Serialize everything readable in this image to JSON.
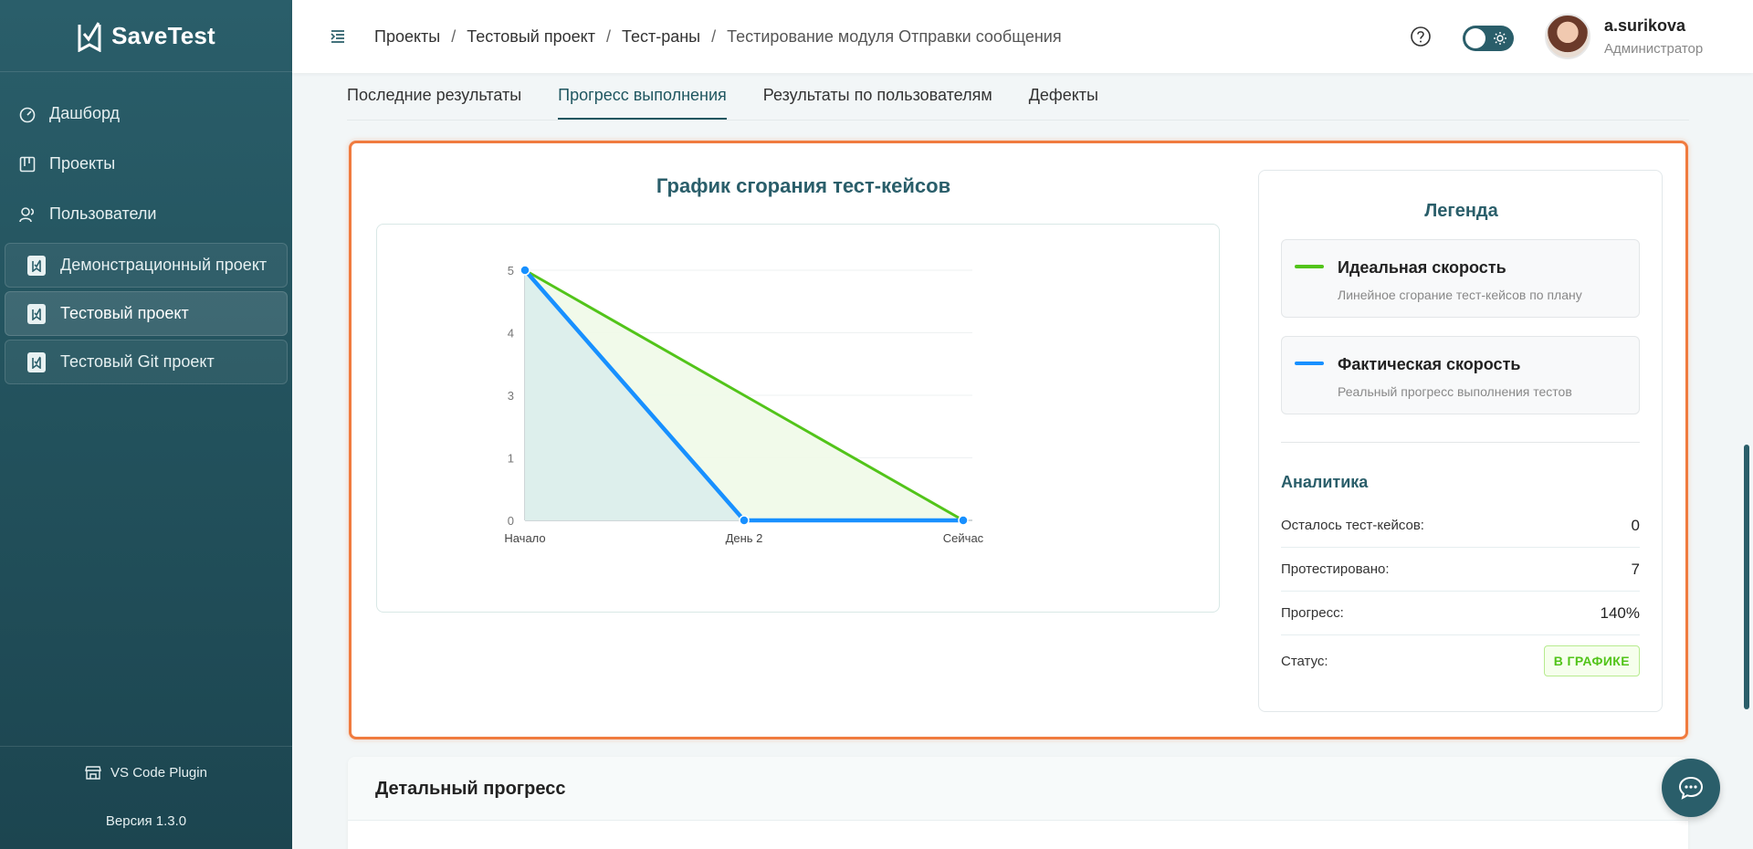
{
  "app": {
    "name": "SaveTest"
  },
  "sidebar": {
    "items": [
      {
        "label": "Дашборд",
        "icon": "dashboard-icon"
      },
      {
        "label": "Проекты",
        "icon": "projects-icon"
      },
      {
        "label": "Пользователи",
        "icon": "users-icon"
      }
    ],
    "projects": [
      {
        "label": "Демонстрационный проект",
        "active": false
      },
      {
        "label": "Тестовый проект",
        "active": true
      },
      {
        "label": "Тестовый Git проект",
        "active": false
      }
    ],
    "plugin_label": "VS Code Plugin",
    "version": "Версия 1.3.0"
  },
  "header": {
    "breadcrumb": [
      "Проекты",
      "Тестовый проект",
      "Тест-раны",
      "Тестирование модуля Отправки сообщения"
    ],
    "separator": "/",
    "user_name": "a.surikova",
    "user_role": "Администратор"
  },
  "tabs": [
    {
      "label": "Последние результаты",
      "active": false
    },
    {
      "label": "Прогресс выполнения",
      "active": true
    },
    {
      "label": "Результаты по пользователям",
      "active": false
    },
    {
      "label": "Дефекты",
      "active": false
    }
  ],
  "burndown": {
    "title": "График сгорания тест-кейсов",
    "legend_title": "Легенда",
    "legend": [
      {
        "name": "Идеальная скорость",
        "desc": "Линейное сгорание тест-кейсов по плану",
        "color": "#52c41a"
      },
      {
        "name": "Фактическая скорость",
        "desc": "Реальный прогресс выполнения тестов",
        "color": "#1890ff"
      }
    ],
    "analytics_title": "Аналитика",
    "stats": [
      {
        "label": "Осталось тест-кейсов:",
        "value": "0"
      },
      {
        "label": "Протестировано:",
        "value": "7"
      },
      {
        "label": "Прогресс:",
        "value": "140%"
      }
    ],
    "status_label": "Статус:",
    "status_value": "В ГРАФИКЕ"
  },
  "chart_data": {
    "type": "line",
    "categories": [
      "Начало",
      "День 2",
      "Сейчас"
    ],
    "y_ticks": [
      "0",
      "1",
      "3",
      "4",
      "5"
    ],
    "ylim": [
      0,
      5
    ],
    "grid": true,
    "series": [
      {
        "name": "Идеальная скорость",
        "values": [
          5,
          2.5,
          0
        ],
        "color": "#52c41a"
      },
      {
        "name": "Фактическая скорость",
        "values": [
          5,
          0,
          0
        ],
        "color": "#1890ff"
      }
    ]
  },
  "detail": {
    "title": "Детальный прогресс"
  }
}
